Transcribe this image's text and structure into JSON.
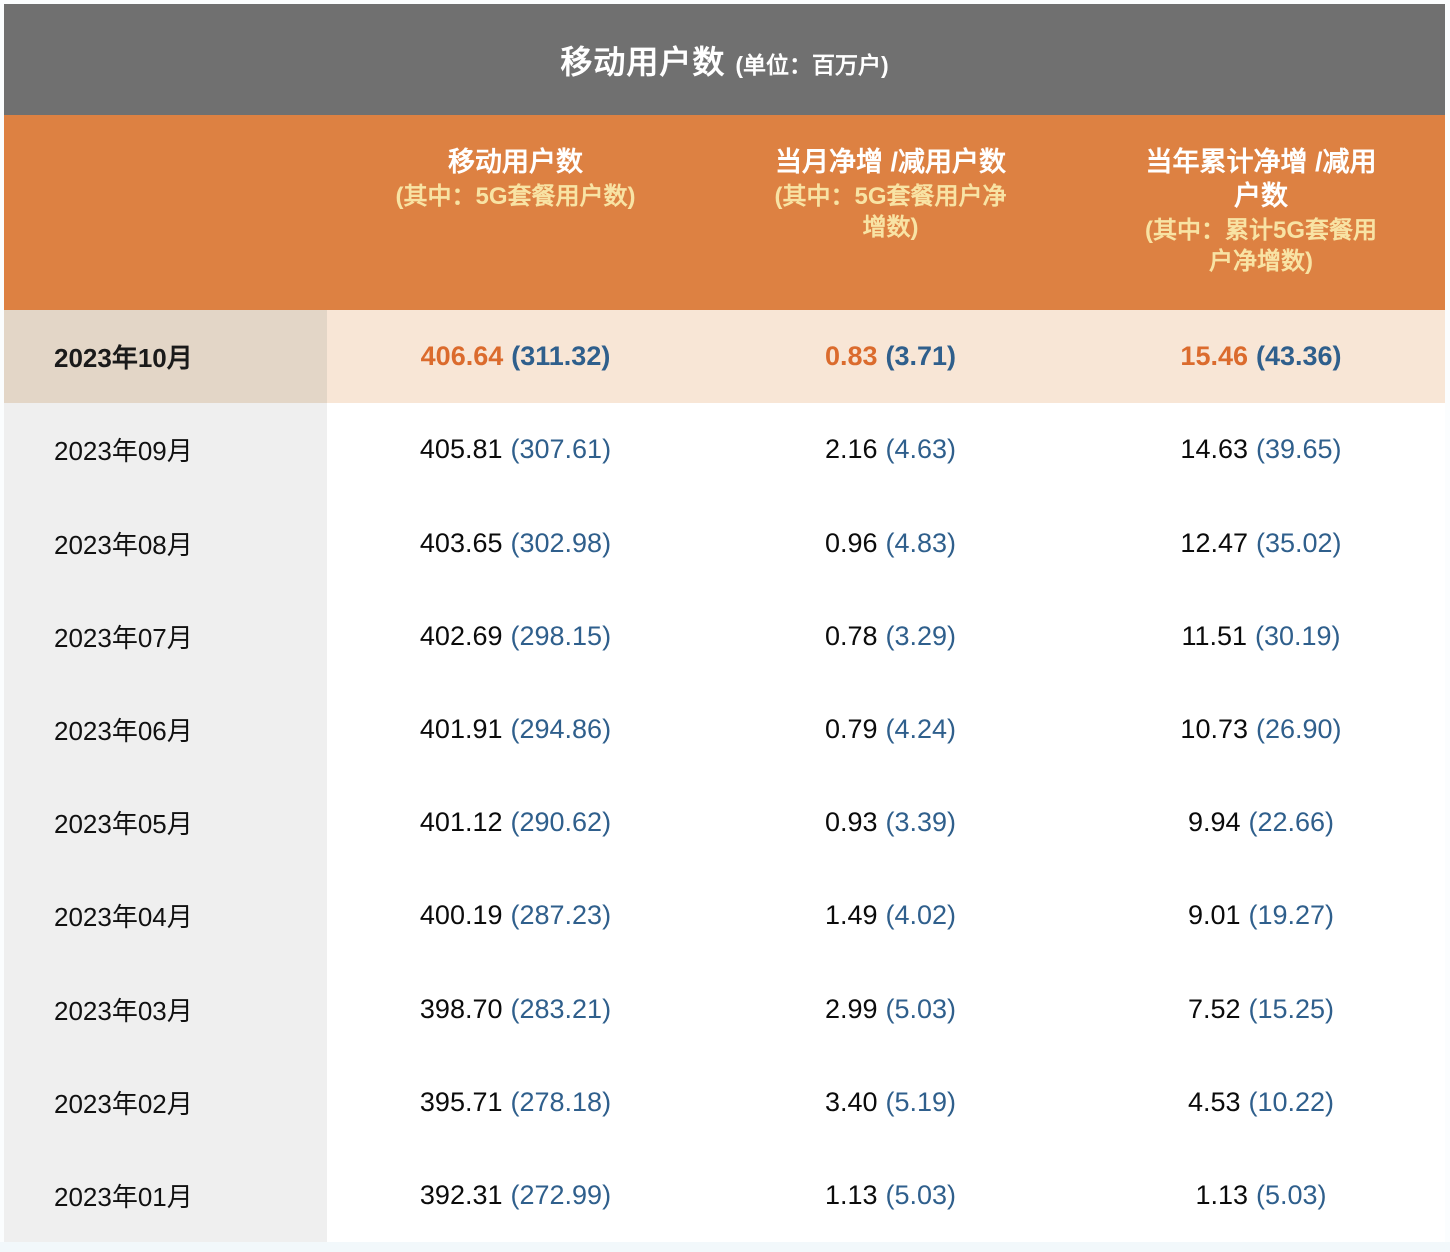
{
  "title": {
    "main": "移动用户数",
    "unit": "(单位：百万户)"
  },
  "header": {
    "columns": [
      {
        "main": "",
        "sub": ""
      },
      {
        "main": "移动用户数",
        "sub": "(其中：5G套餐用户数)"
      },
      {
        "main": "当月净增 /减用户数",
        "sub": "(其中：5G套餐用户净增数)"
      },
      {
        "main": "当年累计净增 /减用户数",
        "sub": "(其中：累计5G套餐用户净增数)"
      }
    ]
  },
  "table": {
    "rows": [
      {
        "month": "2023年10月",
        "mobile": "406.64",
        "mobile_5g": "(311.32)",
        "net": "0.83",
        "net_5g": "(3.71)",
        "cum": "15.46",
        "cum_5g": "(43.36)",
        "highlight": true
      },
      {
        "month": "2023年09月",
        "mobile": "405.81",
        "mobile_5g": "(307.61)",
        "net": "2.16",
        "net_5g": "(4.63)",
        "cum": "14.63",
        "cum_5g": "(39.65)",
        "highlight": false
      },
      {
        "month": "2023年08月",
        "mobile": "403.65",
        "mobile_5g": "(302.98)",
        "net": "0.96",
        "net_5g": "(4.83)",
        "cum": "12.47",
        "cum_5g": "(35.02)",
        "highlight": false
      },
      {
        "month": "2023年07月",
        "mobile": "402.69",
        "mobile_5g": "(298.15)",
        "net": "0.78",
        "net_5g": "(3.29)",
        "cum": "11.51",
        "cum_5g": "(30.19)",
        "highlight": false
      },
      {
        "month": "2023年06月",
        "mobile": "401.91",
        "mobile_5g": "(294.86)",
        "net": "0.79",
        "net_5g": "(4.24)",
        "cum": "10.73",
        "cum_5g": "(26.90)",
        "highlight": false
      },
      {
        "month": "2023年05月",
        "mobile": "401.12",
        "mobile_5g": "(290.62)",
        "net": "0.93",
        "net_5g": "(3.39)",
        "cum": "9.94",
        "cum_5g": "(22.66)",
        "highlight": false
      },
      {
        "month": "2023年04月",
        "mobile": "400.19",
        "mobile_5g": "(287.23)",
        "net": "1.49",
        "net_5g": "(4.02)",
        "cum": "9.01",
        "cum_5g": "(19.27)",
        "highlight": false
      },
      {
        "month": "2023年03月",
        "mobile": "398.70",
        "mobile_5g": "(283.21)",
        "net": "2.99",
        "net_5g": "(5.03)",
        "cum": "7.52",
        "cum_5g": "(15.25)",
        "highlight": false
      },
      {
        "month": "2023年02月",
        "mobile": "395.71",
        "mobile_5g": "(278.18)",
        "net": "3.40",
        "net_5g": "(5.19)",
        "cum": "4.53",
        "cum_5g": "(10.22)",
        "highlight": false
      },
      {
        "month": "2023年01月",
        "mobile": "392.31",
        "mobile_5g": "(272.99)",
        "net": "1.13",
        "net_5g": "(5.03)",
        "cum": "1.13",
        "cum_5g": "(5.03)",
        "highlight": false
      }
    ]
  },
  "colors": {
    "title_bar_bg": "#707070",
    "header_bg": "#DD8142",
    "header_sub_text": "#F8E3A4",
    "highlight_month_bg": "#E3D6C7",
    "highlight_row_bg": "#F8E6D6",
    "month_cell_bg": "#EFEFEF",
    "highlight_value": "#DB6B2D",
    "paren_value": "#2F5F8C",
    "bottom_strip": "#F2F8FB"
  },
  "chart_data": {
    "type": "table",
    "title": "移动用户数",
    "unit": "百万户",
    "columns": [
      "",
      "移动用户数",
      "其中：5G套餐用户数",
      "当月净增/减用户数",
      "其中：5G套餐用户净增数",
      "当年累计净增/减用户数",
      "其中：累计5G套餐用户净增数"
    ],
    "rows": [
      [
        "2023年10月",
        406.64,
        311.32,
        0.83,
        3.71,
        15.46,
        43.36
      ],
      [
        "2023年09月",
        405.81,
        307.61,
        2.16,
        4.63,
        14.63,
        39.65
      ],
      [
        "2023年08月",
        403.65,
        302.98,
        0.96,
        4.83,
        12.47,
        35.02
      ],
      [
        "2023年07月",
        402.69,
        298.15,
        0.78,
        3.29,
        11.51,
        30.19
      ],
      [
        "2023年06月",
        401.91,
        294.86,
        0.79,
        4.24,
        10.73,
        26.9
      ],
      [
        "2023年05月",
        401.12,
        290.62,
        0.93,
        3.39,
        9.94,
        22.66
      ],
      [
        "2023年04月",
        400.19,
        287.23,
        1.49,
        4.02,
        9.01,
        19.27
      ],
      [
        "2023年03月",
        398.7,
        283.21,
        2.99,
        5.03,
        7.52,
        15.25
      ],
      [
        "2023年02月",
        395.71,
        278.18,
        3.4,
        5.19,
        4.53,
        10.22
      ],
      [
        "2023年01月",
        392.31,
        272.99,
        1.13,
        5.03,
        1.13,
        5.03
      ]
    ]
  }
}
